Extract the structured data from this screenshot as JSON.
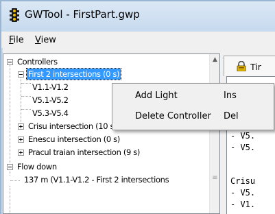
{
  "window": {
    "title": "GWTool - FirstPart.gwp"
  },
  "menu": [
    {
      "prefix": "F",
      "rest": "ile"
    },
    {
      "prefix": "V",
      "rest": "iew"
    }
  ],
  "tree": {
    "rows": [
      {
        "label": "Controllers",
        "expander": "minus"
      },
      {
        "label": "First 2 intersections (0 s)",
        "expander": "minus",
        "selected": true
      },
      {
        "label": "V1.1-V1.2"
      },
      {
        "label": "V5.1-V5.2"
      },
      {
        "label": "V5.3-V5.4"
      },
      {
        "label": "Crisu intersection (10 s)",
        "expander": "plus"
      },
      {
        "label": "Enescu intersection (0 s)",
        "expander": "plus"
      },
      {
        "label": "Pracul traian intersection (9 s)",
        "expander": "plus"
      },
      {
        "label": "Flow down",
        "expander": "minus"
      },
      {
        "label": "137 m (V1.1-V1.2 - First 2 intersections"
      }
    ]
  },
  "scrollbar": {
    "up_arrow": "▲",
    "grip": "≡"
  },
  "tab": {
    "label": "Tir",
    "icon": "lock-icon"
  },
  "text_pane": {
    "lines": [
      "",
      "- V5.",
      "- V5.",
      "",
      "Crisu",
      "- V5.",
      "- V1."
    ]
  },
  "context_menu": {
    "items": [
      {
        "label": "Add Light",
        "shortcut": "Ins"
      },
      {
        "label": "Delete Controller",
        "shortcut": "Del"
      }
    ]
  },
  "colors": {
    "selection": "#3399ff",
    "titlebar": "#c6d9ee",
    "traffic_light_icon": "#1a1a1a"
  }
}
